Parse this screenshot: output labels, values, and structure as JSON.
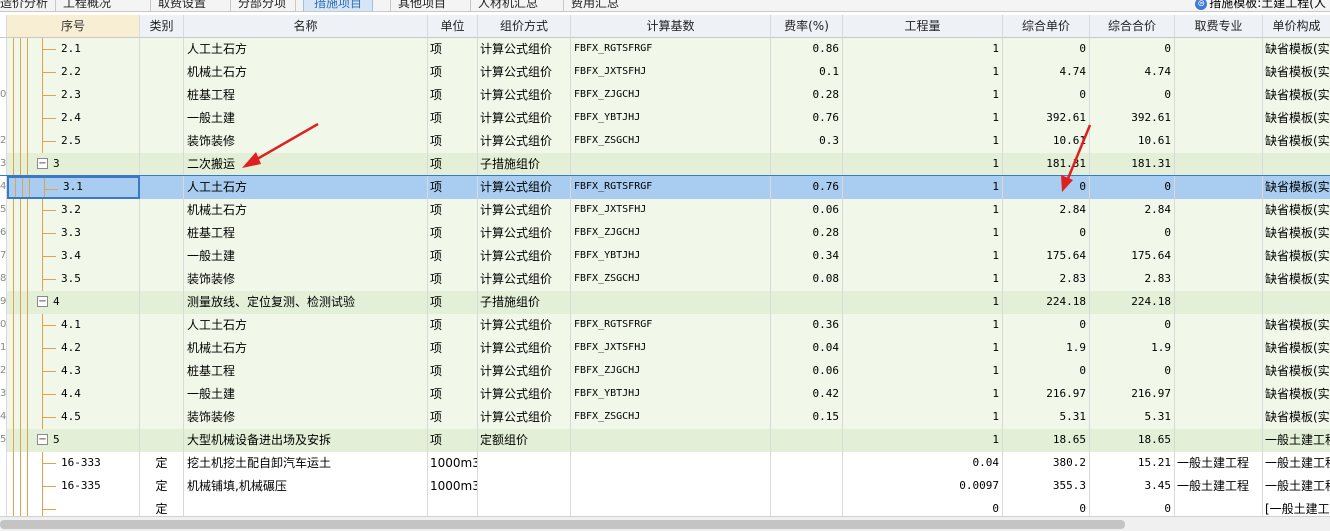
{
  "tabs": [
    {
      "label": "造价分析"
    },
    {
      "label": "工程概况"
    },
    {
      "label": "取费设置"
    },
    {
      "label": "分部分项"
    },
    {
      "label": "措施项目",
      "active": true
    },
    {
      "label": "其他项目"
    },
    {
      "label": "人材机汇总"
    },
    {
      "label": "费用汇总"
    }
  ],
  "template_label": "措施模板:土建工程(人",
  "columns": [
    "序号",
    "类别",
    "名称",
    "单位",
    "组价方式",
    "计算基数",
    "费率(%)",
    "工程量",
    "综合单价",
    "综合合价",
    "取费专业",
    "单价构成"
  ],
  "rows": [
    {
      "kind": "item",
      "num": "",
      "seq": "2.1",
      "type": "",
      "name": "人工土石方",
      "unit": "项",
      "method": "计算公式组价",
      "base": "FBFX_RGTSFRGF",
      "rate": "0.86",
      "qty": "1",
      "price": "0",
      "total": "0",
      "prof": "",
      "comp": "缺省模板(实"
    },
    {
      "kind": "item",
      "num": "",
      "seq": "2.2",
      "type": "",
      "name": "机械土石方",
      "unit": "项",
      "method": "计算公式组价",
      "base": "FBFX_JXTSFHJ",
      "rate": "0.1",
      "qty": "1",
      "price": "4.74",
      "total": "4.74",
      "prof": "",
      "comp": "缺省模板(实"
    },
    {
      "kind": "item",
      "num": "0",
      "seq": "2.3",
      "type": "",
      "name": "桩基工程",
      "unit": "项",
      "method": "计算公式组价",
      "base": "FBFX_ZJGCHJ",
      "rate": "0.28",
      "qty": "1",
      "price": "0",
      "total": "0",
      "prof": "",
      "comp": "缺省模板(实"
    },
    {
      "kind": "item",
      "num": "",
      "seq": "2.4",
      "type": "",
      "name": "一般土建",
      "unit": "项",
      "method": "计算公式组价",
      "base": "FBFX_YBTJHJ",
      "rate": "0.76",
      "qty": "1",
      "price": "392.61",
      "total": "392.61",
      "prof": "",
      "comp": "缺省模板(实"
    },
    {
      "kind": "item",
      "num": "2",
      "seq": "2.5",
      "type": "",
      "name": "装饰装修",
      "unit": "项",
      "method": "计算公式组价",
      "base": "FBFX_ZSGCHJ",
      "rate": "0.3",
      "qty": "1",
      "price": "10.61",
      "total": "10.61",
      "prof": "",
      "comp": "缺省模板(实"
    },
    {
      "kind": "group",
      "num": "3",
      "seq": "3",
      "type": "",
      "name": "二次搬运",
      "unit": "项",
      "method": "子措施组价",
      "base": "",
      "rate": "",
      "qty": "1",
      "price": "181.31",
      "total": "181.31",
      "prof": "",
      "comp": ""
    },
    {
      "kind": "sel",
      "num": "4",
      "seq": "3.1",
      "type": "",
      "name": "人工土石方",
      "unit": "项",
      "method": "计算公式组价",
      "base": "FBFX_RGTSFRGF",
      "rate": "0.76",
      "qty": "1",
      "price": "0",
      "total": "0",
      "prof": "",
      "comp": "缺省模板(实"
    },
    {
      "kind": "item",
      "num": "5",
      "seq": "3.2",
      "type": "",
      "name": "机械土石方",
      "unit": "项",
      "method": "计算公式组价",
      "base": "FBFX_JXTSFHJ",
      "rate": "0.06",
      "qty": "1",
      "price": "2.84",
      "total": "2.84",
      "prof": "",
      "comp": "缺省模板(实"
    },
    {
      "kind": "item",
      "num": "6",
      "seq": "3.3",
      "type": "",
      "name": "桩基工程",
      "unit": "项",
      "method": "计算公式组价",
      "base": "FBFX_ZJGCHJ",
      "rate": "0.28",
      "qty": "1",
      "price": "0",
      "total": "0",
      "prof": "",
      "comp": "缺省模板(实"
    },
    {
      "kind": "item",
      "num": "7",
      "seq": "3.4",
      "type": "",
      "name": "一般土建",
      "unit": "项",
      "method": "计算公式组价",
      "base": "FBFX_YBTJHJ",
      "rate": "0.34",
      "qty": "1",
      "price": "175.64",
      "total": "175.64",
      "prof": "",
      "comp": "缺省模板(实"
    },
    {
      "kind": "item",
      "num": "8",
      "seq": "3.5",
      "type": "",
      "name": "装饰装修",
      "unit": "项",
      "method": "计算公式组价",
      "base": "FBFX_ZSGCHJ",
      "rate": "0.08",
      "qty": "1",
      "price": "2.83",
      "total": "2.83",
      "prof": "",
      "comp": "缺省模板(实"
    },
    {
      "kind": "group",
      "num": "9",
      "seq": "4",
      "type": "",
      "name": "测量放线、定位复测、检测试验",
      "unit": "项",
      "method": "子措施组价",
      "base": "",
      "rate": "",
      "qty": "1",
      "price": "224.18",
      "total": "224.18",
      "prof": "",
      "comp": ""
    },
    {
      "kind": "item",
      "num": "0",
      "seq": "4.1",
      "type": "",
      "name": "人工土石方",
      "unit": "项",
      "method": "计算公式组价",
      "base": "FBFX_RGTSFRGF",
      "rate": "0.36",
      "qty": "1",
      "price": "0",
      "total": "0",
      "prof": "",
      "comp": "缺省模板(实"
    },
    {
      "kind": "item",
      "num": "1",
      "seq": "4.2",
      "type": "",
      "name": "机械土石方",
      "unit": "项",
      "method": "计算公式组价",
      "base": "FBFX_JXTSFHJ",
      "rate": "0.04",
      "qty": "1",
      "price": "1.9",
      "total": "1.9",
      "prof": "",
      "comp": "缺省模板(实"
    },
    {
      "kind": "item",
      "num": "2",
      "seq": "4.3",
      "type": "",
      "name": "桩基工程",
      "unit": "项",
      "method": "计算公式组价",
      "base": "FBFX_ZJGCHJ",
      "rate": "0.06",
      "qty": "1",
      "price": "0",
      "total": "0",
      "prof": "",
      "comp": "缺省模板(实"
    },
    {
      "kind": "item",
      "num": "3",
      "seq": "4.4",
      "type": "",
      "name": "一般土建",
      "unit": "项",
      "method": "计算公式组价",
      "base": "FBFX_YBTJHJ",
      "rate": "0.42",
      "qty": "1",
      "price": "216.97",
      "total": "216.97",
      "prof": "",
      "comp": "缺省模板(实"
    },
    {
      "kind": "item",
      "num": "4",
      "seq": "4.5",
      "type": "",
      "name": "装饰装修",
      "unit": "项",
      "method": "计算公式组价",
      "base": "FBFX_ZSGCHJ",
      "rate": "0.15",
      "qty": "1",
      "price": "5.31",
      "total": "5.31",
      "prof": "",
      "comp": "缺省模板(实"
    },
    {
      "kind": "group",
      "num": "5",
      "seq": "5",
      "type": "",
      "name": "大型机械设备进出场及安拆",
      "unit": "项",
      "method": "定额组价",
      "base": "",
      "rate": "",
      "qty": "1",
      "price": "18.65",
      "total": "18.65",
      "prof": "",
      "comp": "一般土建工程"
    },
    {
      "kind": "def",
      "num": "",
      "seq": "16-333",
      "type": "定",
      "name": "挖土机挖土配自卸汽车运土",
      "unit": "1000m3",
      "method": "",
      "base": "",
      "rate": "",
      "qty": "0.04",
      "price": "380.2",
      "total": "15.21",
      "prof": "一般土建工程",
      "comp": "一般土建工程"
    },
    {
      "kind": "def",
      "num": "",
      "seq": "16-335",
      "type": "定",
      "name": "机械铺填,机械碾压",
      "unit": "1000m3",
      "method": "",
      "base": "",
      "rate": "",
      "qty": "0.0097",
      "price": "355.3",
      "total": "3.45",
      "prof": "一般土建工程",
      "comp": "一般土建工程"
    },
    {
      "kind": "def",
      "num": "",
      "seq": "",
      "type": "定",
      "name": "",
      "unit": "",
      "method": "",
      "base": "",
      "rate": "",
      "qty": "0",
      "price": "0",
      "total": "0",
      "prof": "",
      "comp": "[一般土建工"
    }
  ]
}
